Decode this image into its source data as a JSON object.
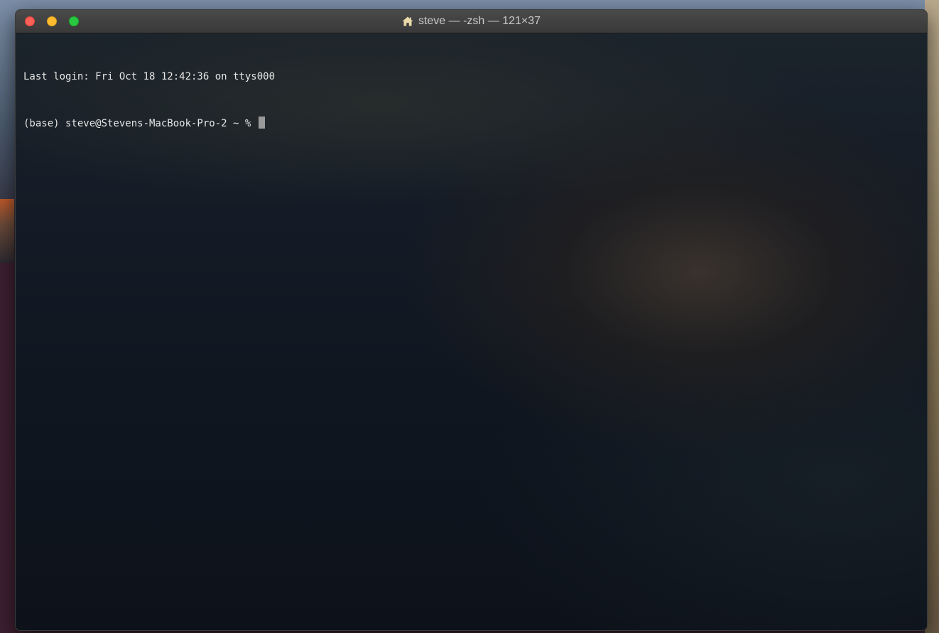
{
  "window": {
    "title": "steve — -zsh — 121×37",
    "title_icon": "home-icon"
  },
  "terminal": {
    "lines": [
      "Last login: Fri Oct 18 12:42:36 on ttys000"
    ],
    "prompt": "(base) steve@Stevens-MacBook-Pro-2 ~ % "
  },
  "colors": {
    "close": "#fe5f57",
    "minimize": "#febc2e",
    "maximize": "#28c840"
  }
}
